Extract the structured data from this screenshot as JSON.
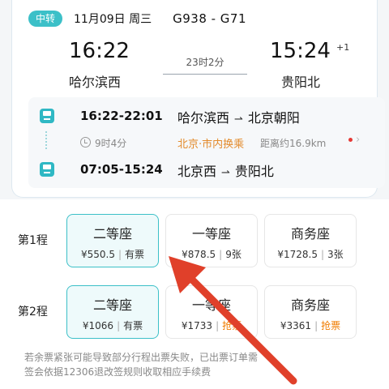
{
  "header": {
    "badge": "中转",
    "date": "11月09日 周三",
    "trains": "G938 - G71"
  },
  "journey": {
    "depart_time": "16:22",
    "depart_station": "哈尔滨西",
    "duration": "23时2分",
    "arrive_time": "15:24",
    "arrive_plus": "+1",
    "arrive_station": "贵阳北"
  },
  "legs": [
    {
      "time": "16:22-22:01",
      "from": "哈尔滨西",
      "to": "北京朝阳"
    },
    {
      "time": "07:05-15:24",
      "from": "北京西",
      "to": "贵阳北"
    }
  ],
  "transfer": {
    "wait": "9时4分",
    "note": "北京·市内换乘",
    "distance": "距离约16.9km"
  },
  "seat_rows": [
    {
      "label": "第1程",
      "seats": [
        {
          "name": "二等座",
          "price": "¥550.5",
          "avail": "有票"
        },
        {
          "name": "一等座",
          "price": "¥878.5",
          "avail": "9张"
        },
        {
          "name": "商务座",
          "price": "¥1728.5",
          "avail": "3张"
        }
      ]
    },
    {
      "label": "第2程",
      "seats": [
        {
          "name": "二等座",
          "price": "¥1066",
          "avail": "有票"
        },
        {
          "name": "一等座",
          "price": "¥1733",
          "avail": "抢票"
        },
        {
          "name": "商务座",
          "price": "¥3361",
          "avail": "抢票"
        }
      ]
    }
  ],
  "footnote": {
    "line1": "若余票紧张可能导致部分行程出票失败，已出票订单需",
    "line2": "签会依据12306退改签规则收取相应手续费"
  },
  "colors": {
    "accent": "#3cc0c8",
    "transfer_orange": "#e38a2b",
    "grab_orange": "#f07c00",
    "annotation_red": "#e0402a"
  },
  "icons": [
    "train-icon",
    "clock-icon",
    "arrow-right-icon",
    "chevron-right-icon",
    "red-annotation-arrow"
  ]
}
